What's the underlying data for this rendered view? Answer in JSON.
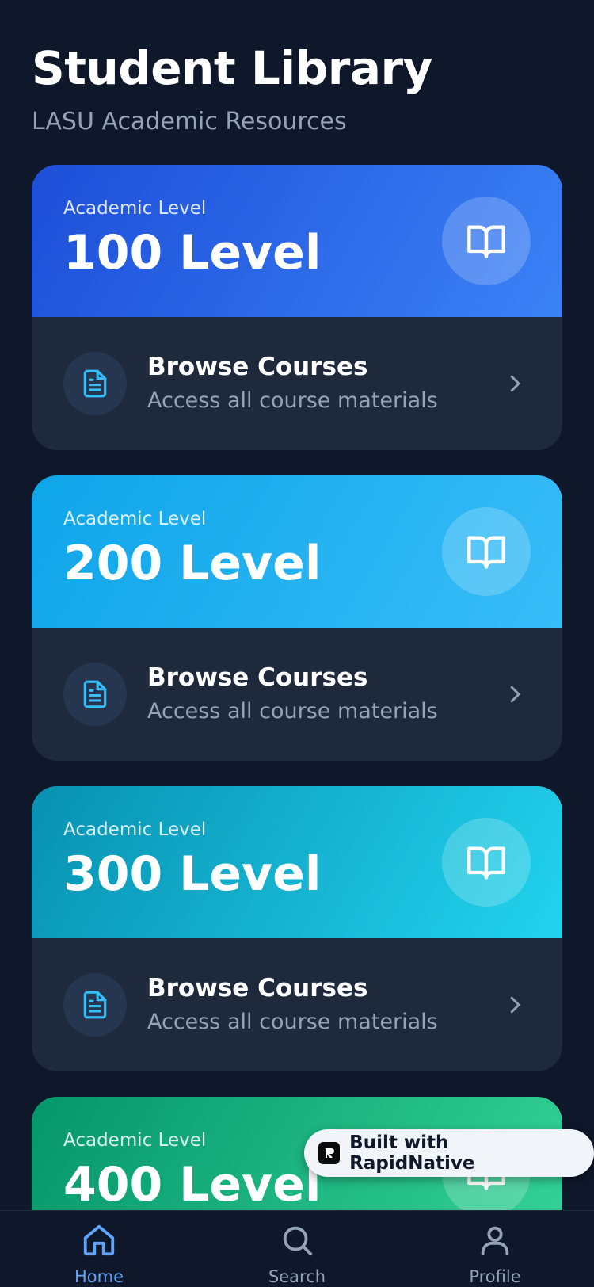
{
  "header": {
    "title": "Student Library",
    "subtitle": "LASU Academic Resources"
  },
  "levels": [
    {
      "eyebrow": "Academic Level",
      "name": "100 Level",
      "browse_title": "Browse Courses",
      "browse_subtitle": "Access all course materials",
      "book_icon": "book-open-icon",
      "doc_icon": "document-icon"
    },
    {
      "eyebrow": "Academic Level",
      "name": "200 Level",
      "browse_title": "Browse Courses",
      "browse_subtitle": "Access all course materials",
      "book_icon": "book-open-icon",
      "doc_icon": "document-icon"
    },
    {
      "eyebrow": "Academic Level",
      "name": "300 Level",
      "browse_title": "Browse Courses",
      "browse_subtitle": "Access all course materials",
      "book_icon": "book-open-icon",
      "doc_icon": "document-icon"
    },
    {
      "eyebrow": "Academic Level",
      "name": "400 Level",
      "book_icon": "book-open-icon"
    }
  ],
  "badge": {
    "label": "Built with RapidNative"
  },
  "tabbar": {
    "tabs": [
      {
        "label": "Home",
        "icon": "home-icon",
        "active": true
      },
      {
        "label": "Search",
        "icon": "search-icon",
        "active": false
      },
      {
        "label": "Profile",
        "icon": "user-icon",
        "active": false
      }
    ]
  },
  "colors": {
    "background": "#0f172a",
    "card_body": "#1e293b",
    "accent": "#60a5fa",
    "muted_text": "#94a3b8",
    "level_100": "#2563eb",
    "level_200": "#0ea5e9",
    "level_300": "#06b6d4",
    "level_400": "#10b981"
  }
}
